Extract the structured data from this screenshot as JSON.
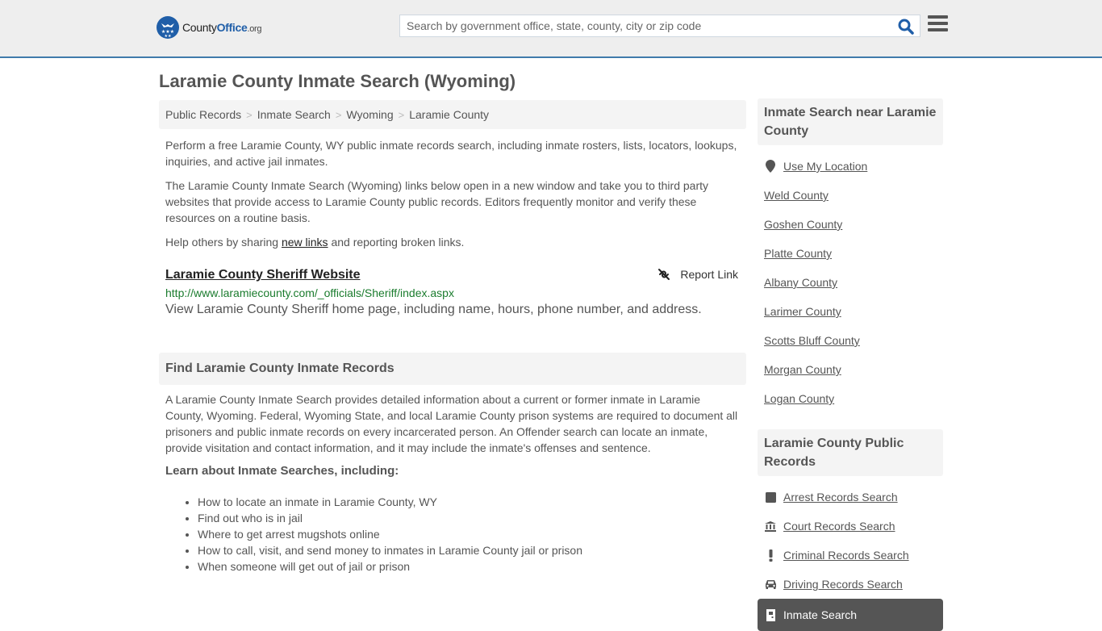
{
  "header": {
    "logo": {
      "part1": "County",
      "part2": "Office",
      "part3": ".org"
    },
    "search_placeholder": "Search by government office, state, county, city or zip code",
    "search_value": ""
  },
  "page_title": "Laramie County Inmate Search (Wyoming)",
  "breadcrumb": [
    {
      "label": "Public Records"
    },
    {
      "label": "Inmate Search"
    },
    {
      "label": "Wyoming"
    },
    {
      "label": "Laramie County"
    }
  ],
  "breadcrumb_separator": ">",
  "intro": {
    "p1": "Perform a free Laramie County, WY public inmate records search, including inmate rosters, lists, locators, lookups, inquiries, and active jail inmates.",
    "p2": "The Laramie County Inmate Search (Wyoming) links below open in a new window and take you to third party websites that provide access to Laramie County public records. Editors frequently monitor and verify these resources on a routine basis.",
    "p3_before": "Help others by sharing ",
    "p3_link": "new links",
    "p3_after": " and reporting broken links."
  },
  "result": {
    "title": "Laramie County Sheriff Website",
    "report_label": "Report Link",
    "url": "http://www.laramiecounty.com/_officials/Sheriff/index.aspx",
    "description": "View Laramie County Sheriff home page, including name, hours, phone number, and address."
  },
  "find_section": {
    "heading": "Find Laramie County Inmate Records",
    "body": "A Laramie County Inmate Search provides detailed information about a current or former inmate in Laramie County, Wyoming. Federal, Wyoming State, and local Laramie County prison systems are required to document all prisoners and public inmate records on every incarcerated person. An Offender search can locate an inmate, provide visitation and contact information, and it may include the inmate's offenses and sentence.",
    "learn_heading": "Learn about Inmate Searches, including:",
    "bullets": [
      "How to locate an inmate in Laramie County, WY",
      "Find out who is in jail",
      "Where to get arrest mugshots online",
      "How to call, visit, and send money to inmates in Laramie County jail or prison",
      "When someone will get out of jail or prison"
    ]
  },
  "sidebar": {
    "nearby": {
      "heading": "Inmate Search near Laramie County",
      "use_location": "Use My Location",
      "counties": [
        "Weld County",
        "Goshen County",
        "Platte County",
        "Albany County",
        "Larimer County",
        "Scotts Bluff County",
        "Morgan County",
        "Logan County"
      ]
    },
    "public_records": {
      "heading": "Laramie County Public Records",
      "items": [
        {
          "label": "Arrest Records Search",
          "icon": "square-icon"
        },
        {
          "label": "Court Records Search",
          "icon": "courthouse-icon"
        },
        {
          "label": "Criminal Records Search",
          "icon": "exclamation-icon"
        },
        {
          "label": "Driving Records Search",
          "icon": "car-icon"
        },
        {
          "label": "Inmate Search",
          "icon": "jail-door-icon",
          "active": true
        }
      ]
    }
  },
  "colors": {
    "brand_blue": "#1f5ea8",
    "header_border": "#3f7aab",
    "url_green": "#1b7c2e",
    "active_bg": "#555555"
  }
}
